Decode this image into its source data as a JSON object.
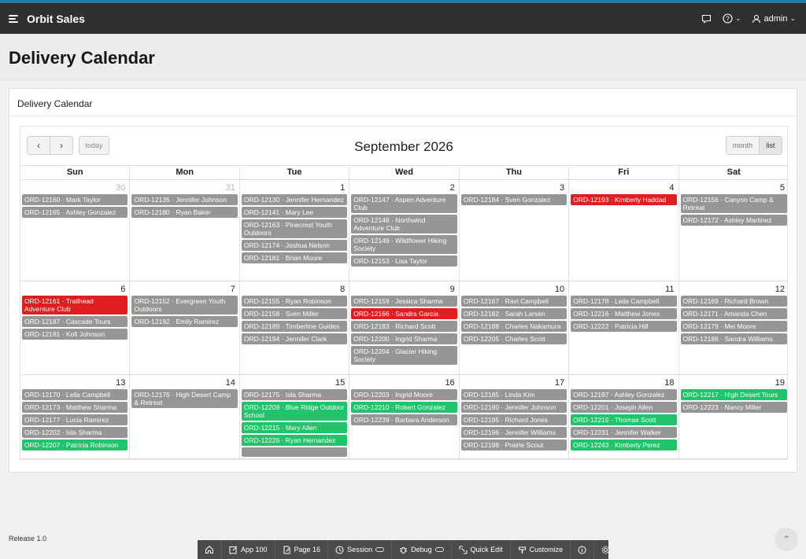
{
  "app": {
    "name": "Orbit Sales",
    "user": "admin"
  },
  "page": {
    "title": "Delivery Calendar"
  },
  "region": {
    "title": "Delivery Calendar"
  },
  "calendar": {
    "title": "September 2026",
    "today_label": "today",
    "view_month": "month",
    "view_list": "list",
    "days_of_week": [
      "Sun",
      "Mon",
      "Tue",
      "Wed",
      "Thu",
      "Fri",
      "Sat"
    ],
    "weeks": [
      [
        {
          "num": "30",
          "other": true,
          "events": [
            {
              "label": "ORD-12160 · Mark Taylor",
              "status": "gray"
            },
            {
              "label": "ORD-12165 · Ashley Gonzalez",
              "status": "gray"
            }
          ]
        },
        {
          "num": "31",
          "other": true,
          "events": [
            {
              "label": "ORD-12135 · Jennifer Johnson",
              "status": "gray"
            },
            {
              "label": "ORD-12180 · Ryan Baker",
              "status": "gray"
            }
          ]
        },
        {
          "num": "1",
          "events": [
            {
              "label": "ORD-12130 · Jennifer Hernandez",
              "status": "gray"
            },
            {
              "label": "ORD-12141 · Mary Lee",
              "status": "gray"
            },
            {
              "label": "ORD-12163 · Pinecrest Youth Outdoors",
              "status": "gray"
            },
            {
              "label": "ORD-12174 · Joshua Nelson",
              "status": "gray"
            },
            {
              "label": "ORD-12181 · Brian Moore",
              "status": "gray"
            }
          ]
        },
        {
          "num": "2",
          "events": [
            {
              "label": "ORD-12147 · Aspen Adventure Club",
              "status": "gray"
            },
            {
              "label": "ORD-12148 · Northwind Adventure Club",
              "status": "gray"
            },
            {
              "label": "ORD-12149 · Wildflower Hiking Society",
              "status": "gray"
            },
            {
              "label": "ORD-12153 · Lisa Taylor",
              "status": "gray"
            }
          ]
        },
        {
          "num": "3",
          "events": [
            {
              "label": "ORD-12184 · Sven Gonzalez",
              "status": "gray"
            }
          ]
        },
        {
          "num": "4",
          "events": [
            {
              "label": "ORD-12193 · Kimberly Haddad",
              "status": "red"
            }
          ]
        },
        {
          "num": "5",
          "events": [
            {
              "label": "ORD-12156 · Canyon Camp & Retreat",
              "status": "gray"
            },
            {
              "label": "ORD-12172 · Ashley Martinez",
              "status": "gray"
            }
          ]
        }
      ],
      [
        {
          "num": "6",
          "events": [
            {
              "label": "ORD-12161 · Trailhead Adventure Club",
              "status": "red"
            },
            {
              "label": "ORD-12187 · Cascade Tours",
              "status": "gray"
            },
            {
              "label": "ORD-12191 · Kofi Johnson",
              "status": "gray"
            }
          ]
        },
        {
          "num": "7",
          "events": [
            {
              "label": "ORD-12152 · Evergreen Youth Outdoors",
              "status": "gray"
            },
            {
              "label": "ORD-12192 · Emily Ramirez",
              "status": "gray"
            }
          ]
        },
        {
          "num": "8",
          "events": [
            {
              "label": "ORD-12155 · Ryan Robinson",
              "status": "gray"
            },
            {
              "label": "ORD-12158 · Sven Miller",
              "status": "gray"
            },
            {
              "label": "ORD-12189 · Timberline Guides",
              "status": "gray"
            },
            {
              "label": "ORD-12194 · Jennifer Clark",
              "status": "gray"
            }
          ]
        },
        {
          "num": "9",
          "events": [
            {
              "label": "ORD-12159 · Jessica Sharma",
              "status": "gray"
            },
            {
              "label": "ORD-12166 · Sandra Garcia",
              "status": "red"
            },
            {
              "label": "ORD-12183 · Richard Scott",
              "status": "gray"
            },
            {
              "label": "ORD-12200 · Ingrid Sharma",
              "status": "gray"
            },
            {
              "label": "ORD-12204 · Glacier Hiking Society",
              "status": "gray"
            }
          ]
        },
        {
          "num": "10",
          "events": [
            {
              "label": "ORD-12167 · Ravi Campbell",
              "status": "gray"
            },
            {
              "label": "ORD-12182 · Sarah Larsen",
              "status": "gray"
            },
            {
              "label": "ORD-12188 · Charles Nakamura",
              "status": "gray"
            },
            {
              "label": "ORD-12205 · Charles Scott",
              "status": "gray"
            }
          ]
        },
        {
          "num": "11",
          "events": [
            {
              "label": "ORD-12178 · Leila Campbell",
              "status": "gray"
            },
            {
              "label": "ORD-12216 · Matthew Jones",
              "status": "gray"
            },
            {
              "label": "ORD-12222 · Patricia Hill",
              "status": "gray"
            }
          ]
        },
        {
          "num": "12",
          "events": [
            {
              "label": "ORD-12169 · Richard Brown",
              "status": "gray"
            },
            {
              "label": "ORD-12171 · Amanda Chen",
              "status": "gray"
            },
            {
              "label": "ORD-12179 · Mei Moore",
              "status": "gray"
            },
            {
              "label": "ORD-12186 · Sandra Williams",
              "status": "gray"
            }
          ]
        }
      ],
      [
        {
          "num": "13",
          "events": [
            {
              "label": "ORD-12170 · Leila Campbell",
              "status": "gray"
            },
            {
              "label": "ORD-12173 · Matthew Sharma",
              "status": "gray"
            },
            {
              "label": "ORD-12177 · Lucia Ramirez",
              "status": "gray"
            },
            {
              "label": "ORD-12202 · Isla Sharma",
              "status": "gray"
            },
            {
              "label": "ORD-12207 · Patricia Robinson",
              "status": "green"
            }
          ]
        },
        {
          "num": "14",
          "events": [
            {
              "label": "ORD-12176 · High Desert Camp & Retreat",
              "status": "gray"
            }
          ]
        },
        {
          "num": "15",
          "events": [
            {
              "label": "ORD-12175 · Isla Sharma",
              "status": "gray"
            },
            {
              "label": "ORD-12209 · Blue Ridge Outdoor School",
              "status": "green"
            },
            {
              "label": "ORD-12215 · Mary Allen",
              "status": "green"
            },
            {
              "label": "ORD-12226 · Ryan Hernandez",
              "status": "green"
            },
            {
              "label": "",
              "status": "gray"
            }
          ]
        },
        {
          "num": "16",
          "events": [
            {
              "label": "ORD-12203 · Ingrid Moore",
              "status": "gray"
            },
            {
              "label": "ORD-12210 · Robert Gonzalez",
              "status": "green"
            },
            {
              "label": "ORD-12239 · Barbara Anderson",
              "status": "gray"
            }
          ]
        },
        {
          "num": "17",
          "events": [
            {
              "label": "ORD-12185 · Linda Kim",
              "status": "gray"
            },
            {
              "label": "ORD-12190 · Jennifer Johnson",
              "status": "gray"
            },
            {
              "label": "ORD-12195 · Richard Jones",
              "status": "gray"
            },
            {
              "label": "ORD-12196 · Jennifer Williams",
              "status": "gray"
            },
            {
              "label": "ORD-12198 · Prairie Scout",
              "status": "gray"
            }
          ]
        },
        {
          "num": "18",
          "events": [
            {
              "label": "ORD-12197 · Ashley Gonzalez",
              "status": "gray"
            },
            {
              "label": "ORD-12201 · Joseph Allen",
              "status": "gray"
            },
            {
              "label": "ORD-12219 · Thomas Scott",
              "status": "green"
            },
            {
              "label": "ORD-12231 · Jennifer Walker",
              "status": "gray"
            },
            {
              "label": "ORD-12243 · Kimberly Perez",
              "status": "green"
            }
          ]
        },
        {
          "num": "19",
          "events": [
            {
              "label": "ORD-12217 · High Desert Tours",
              "status": "green"
            },
            {
              "label": "ORD-12223 · Nancy Miller",
              "status": "gray"
            }
          ]
        }
      ]
    ],
    "colors": {
      "gray": "#969696",
      "red": "#df1f1f",
      "green": "#21c36b"
    }
  },
  "footer": {
    "release": "Release 1.0"
  },
  "devbar": {
    "home_icon": "home-icon",
    "app": "App 100",
    "page": "Page 16",
    "session": "Session",
    "debug": "Debug",
    "quick_edit": "Quick Edit",
    "customize": "Customize"
  }
}
